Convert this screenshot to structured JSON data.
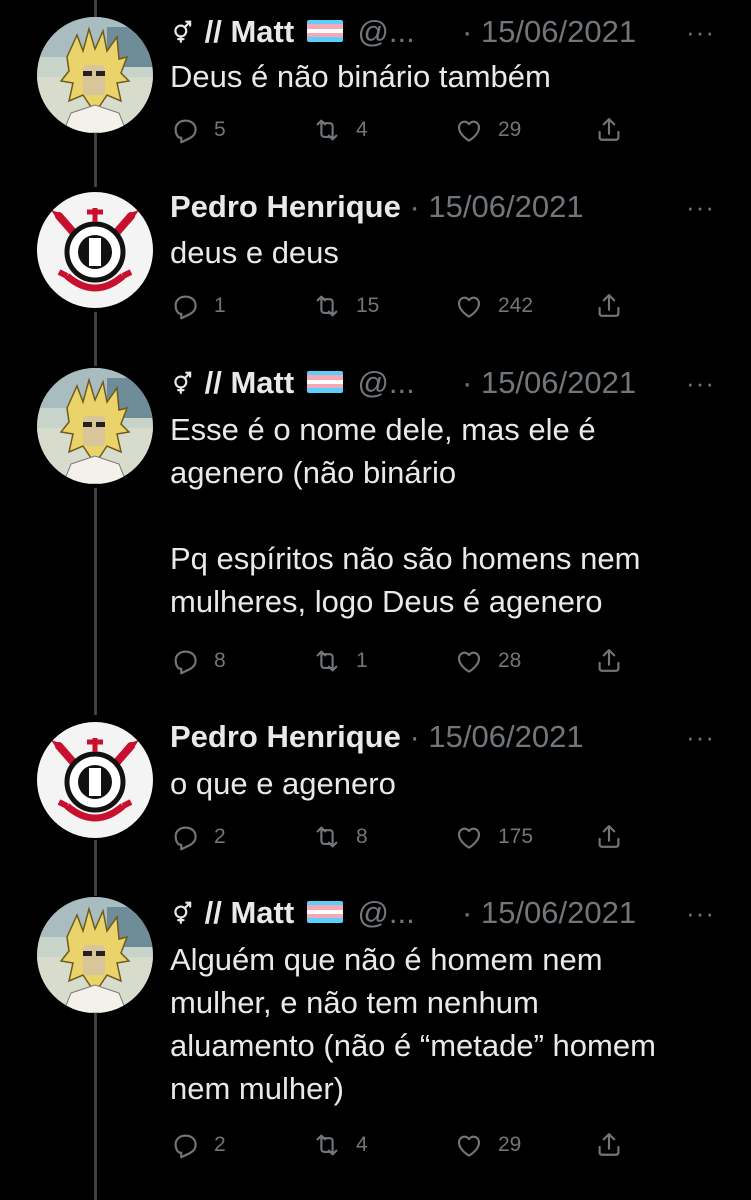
{
  "tweets": [
    {
      "author": "// Matt",
      "handle": "@...",
      "date": "15/06/2021",
      "avatar": "anime-character-avatar",
      "badge_icon": "gender-symbol-icon",
      "flag": "trans-flag",
      "text": "Deus é não binário também",
      "replies": "5",
      "retweets": "4",
      "likes": "29"
    },
    {
      "author": "Pedro Henrique",
      "handle": "",
      "date": "15/06/2021",
      "avatar": "corinthians-crest-avatar",
      "text": "deus e deus",
      "replies": "1",
      "retweets": "15",
      "likes": "242"
    },
    {
      "author": "// Matt",
      "handle": "@...",
      "date": "15/06/2021",
      "avatar": "anime-character-avatar",
      "badge_icon": "gender-symbol-icon",
      "flag": "trans-flag",
      "text": "Esse é o nome dele, mas ele é\nagenero (não binário\n\nPq espíritos não são homens nem\nmulheres, logo Deus é agenero",
      "replies": "8",
      "retweets": "1",
      "likes": "28"
    },
    {
      "author": "Pedro Henrique",
      "handle": "",
      "date": "15/06/2021",
      "avatar": "corinthians-crest-avatar",
      "text": "o que e agenero",
      "replies": "2",
      "retweets": "8",
      "likes": "175"
    },
    {
      "author": "// Matt",
      "handle": "@...",
      "date": "15/06/2021",
      "avatar": "anime-character-avatar",
      "badge_icon": "gender-symbol-icon",
      "flag": "trans-flag",
      "text": "Alguém que não é homem nem\nmulher, e não tem nenhum\naluamento (não é “metade” homem\nnem mulher)",
      "replies": "2",
      "retweets": "4",
      "likes": "29"
    }
  ],
  "separator": "·",
  "more_label": "···",
  "colors": {
    "background": "#000000",
    "text": "#e7e9ea",
    "secondary": "#71767b",
    "thread_line": "#3e4144"
  }
}
